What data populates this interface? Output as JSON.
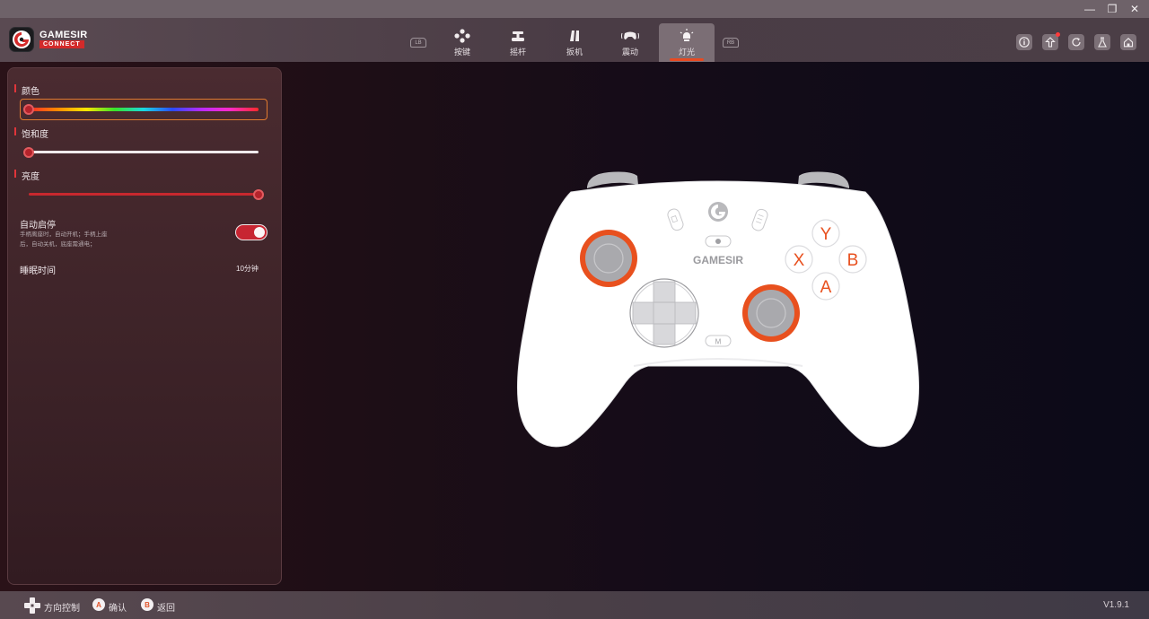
{
  "window": {
    "minimize": "—",
    "restore": "❐",
    "close": "✕"
  },
  "brand": {
    "name": "GAMESIR",
    "sub": "CONNECT"
  },
  "nav": {
    "lb": "LB",
    "rb": "RB",
    "tabs": [
      {
        "label": "按键",
        "icon": "buttons-icon"
      },
      {
        "label": "摇杆",
        "icon": "joystick-icon"
      },
      {
        "label": "扳机",
        "icon": "trigger-icon"
      },
      {
        "label": "震动",
        "icon": "vibration-icon"
      },
      {
        "label": "灯光",
        "icon": "light-icon",
        "active": true
      }
    ]
  },
  "header_icons": [
    "info-icon",
    "upload-icon",
    "refresh-icon",
    "lab-icon",
    "home-icon"
  ],
  "light": {
    "color_label": "颜色",
    "color_value": 0.0,
    "saturation_label": "饱和度",
    "saturation_value": 0.0,
    "brightness_label": "亮度",
    "brightness_value": 1.0,
    "auto_label": "自动启停",
    "auto_desc_line1": "手柄离座时，自动开机；手柄上座",
    "auto_desc_line2": "后，自动关机，底座需通电；",
    "auto_enabled": true,
    "sleep_label": "睡眠时间",
    "sleep_value": "10分钟"
  },
  "controller": {
    "brand": "GAMESIR",
    "y": "Y",
    "x": "X",
    "b": "B",
    "a": "A",
    "m": "M",
    "accent": "#e8501e"
  },
  "footer": {
    "dpad_hint": "方向控制",
    "a_key": "A",
    "confirm": "确认",
    "b_key": "B",
    "back": "返回",
    "version": "V1.9.1"
  }
}
